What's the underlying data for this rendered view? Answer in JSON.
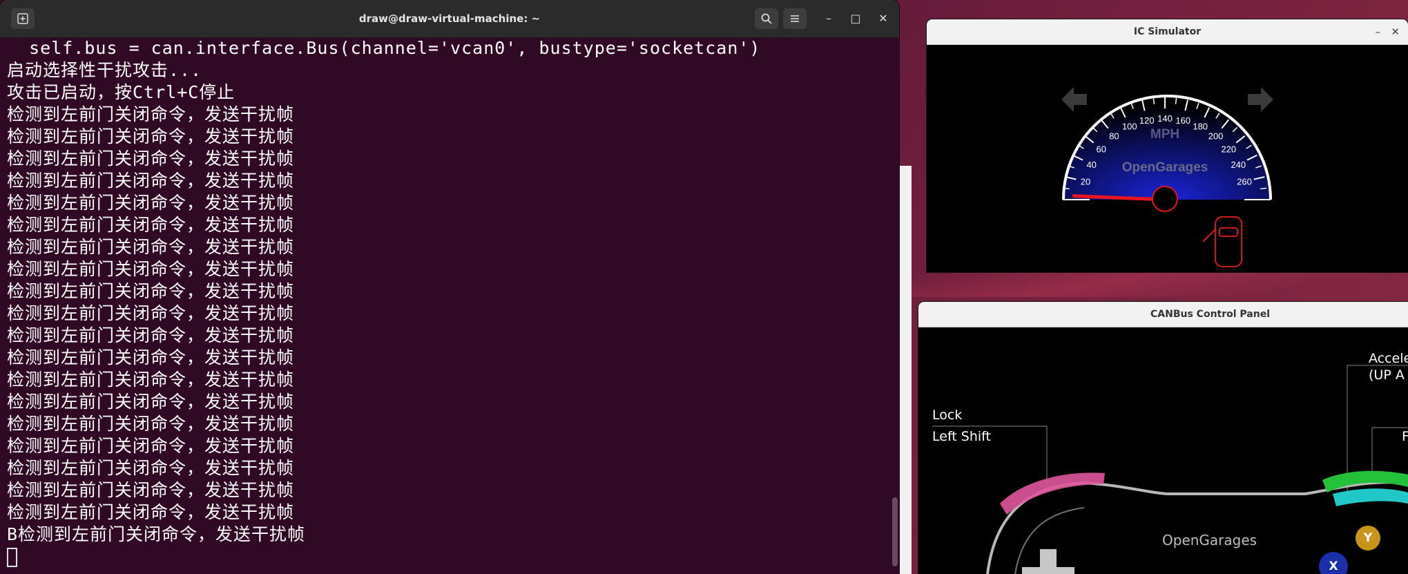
{
  "terminal": {
    "title": "draw@draw-virtual-machine: ~",
    "lines": [
      "  self.bus = can.interface.Bus(channel='vcan0', bustype='socketcan')",
      "启动选择性干扰攻击...",
      "攻击已启动，按Ctrl+C停止",
      "检测到左前门关闭命令，发送干扰帧",
      "检测到左前门关闭命令，发送干扰帧",
      "检测到左前门关闭命令，发送干扰帧",
      "检测到左前门关闭命令，发送干扰帧",
      "检测到左前门关闭命令，发送干扰帧",
      "检测到左前门关闭命令，发送干扰帧",
      "检测到左前门关闭命令，发送干扰帧",
      "检测到左前门关闭命令，发送干扰帧",
      "检测到左前门关闭命令，发送干扰帧",
      "检测到左前门关闭命令，发送干扰帧",
      "检测到左前门关闭命令，发送干扰帧",
      "检测到左前门关闭命令，发送干扰帧",
      "检测到左前门关闭命令，发送干扰帧",
      "检测到左前门关闭命令，发送干扰帧",
      "检测到左前门关闭命令，发送干扰帧",
      "检测到左前门关闭命令，发送干扰帧",
      "检测到左前门关闭命令，发送干扰帧",
      "检测到左前门关闭命令，发送干扰帧",
      "检测到左前门关闭命令，发送干扰帧",
      "B检测到左前门关闭命令，发送干扰帧"
    ]
  },
  "ic": {
    "title": "IC Simulator",
    "unit": "MPH",
    "brand": "OpenGarages",
    "ticks": [
      "20",
      "40",
      "60",
      "80",
      "100",
      "120",
      "140",
      "160",
      "180",
      "200",
      "220",
      "240",
      "260"
    ],
    "speed": 0,
    "colors": {
      "needle": "#e8141e",
      "dial": "#1a24d8",
      "arrow": "#3a3a3a"
    }
  },
  "can": {
    "title": "CANBus Control Panel",
    "lock_label": "Lock",
    "shift_label": "Left Shift",
    "accel_label": "Accele",
    "accel_sub": "(UP A",
    "brand": "OpenGarages",
    "btn_y": "Y",
    "btn_x": "X",
    "right_partial": "F"
  }
}
